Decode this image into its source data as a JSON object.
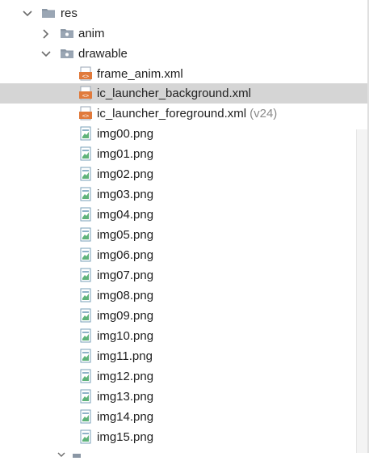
{
  "tree": {
    "root": {
      "label": "res",
      "expanded": true
    },
    "folders": [
      {
        "label": "anim",
        "expanded": false
      },
      {
        "label": "drawable",
        "expanded": true
      }
    ],
    "xml_files": [
      {
        "label": "frame_anim.xml",
        "hint": ""
      },
      {
        "label": "ic_launcher_background.xml",
        "hint": "",
        "selected": true
      },
      {
        "label": "ic_launcher_foreground.xml",
        "hint": "(v24)"
      }
    ],
    "png_files": [
      "img00.png",
      "img01.png",
      "img02.png",
      "img03.png",
      "img04.png",
      "img05.png",
      "img06.png",
      "img07.png",
      "img08.png",
      "img09.png",
      "img10.png",
      "img11.png",
      "img12.png",
      "img13.png",
      "img14.png",
      "img15.png"
    ]
  },
  "colors": {
    "selection": "#d5d5d5",
    "folder": "#8b97a5",
    "xml_icon": "#e07a3c",
    "image_icon_frame": "#7aa0b8",
    "image_icon_fill": "#5fb37a"
  }
}
